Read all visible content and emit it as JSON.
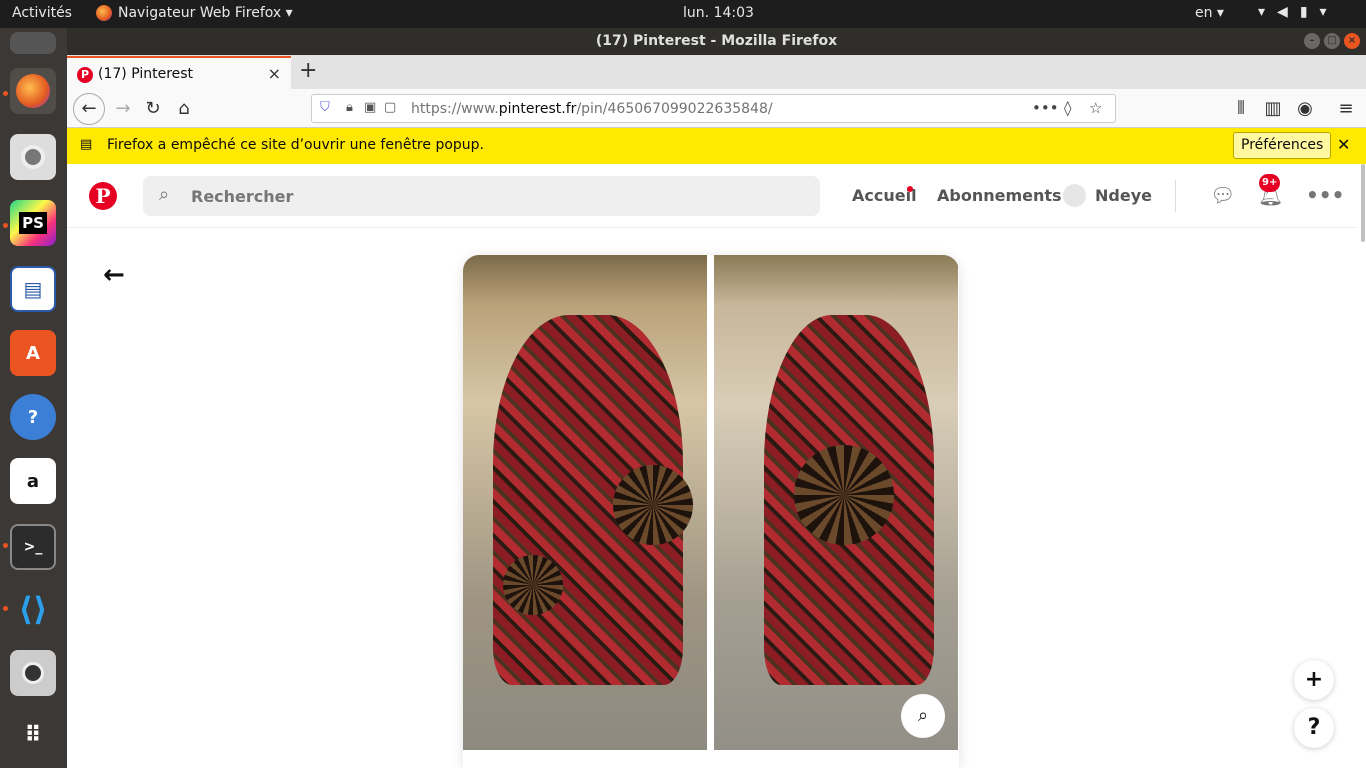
{
  "system": {
    "activities": "Activités",
    "app_name": "Navigateur Web Firefox ▾",
    "clock": "lun. 14:03",
    "lang": "en ▾",
    "tray": [
      "wifi-icon",
      "volume-icon",
      "battery-icon",
      "menu-caret"
    ]
  },
  "window": {
    "title": "(17) Pinterest - Mozilla Firefox"
  },
  "tab": {
    "label": "(17) Pinterest",
    "close": "×"
  },
  "url": {
    "prefix": "https://www.",
    "domain": "pinterest.fr",
    "path": "/pin/465067099022635848/"
  },
  "notification": {
    "message": "Firefox a empêché ce site d’ouvrir une fenêtre popup.",
    "button": "Préférences",
    "close": "✕"
  },
  "pinterest": {
    "logo": "P",
    "search_placeholder": "Rechercher",
    "nav": {
      "home": "Accueil",
      "following": "Abonnements",
      "user": "Ndeye"
    },
    "notif_badge": "9+"
  },
  "fab": {
    "add": "+",
    "help": "?"
  },
  "colors": {
    "pinterest_red": "#e60023",
    "notif_bar": "#ffe900",
    "ubuntu_orange": "#e95420"
  }
}
